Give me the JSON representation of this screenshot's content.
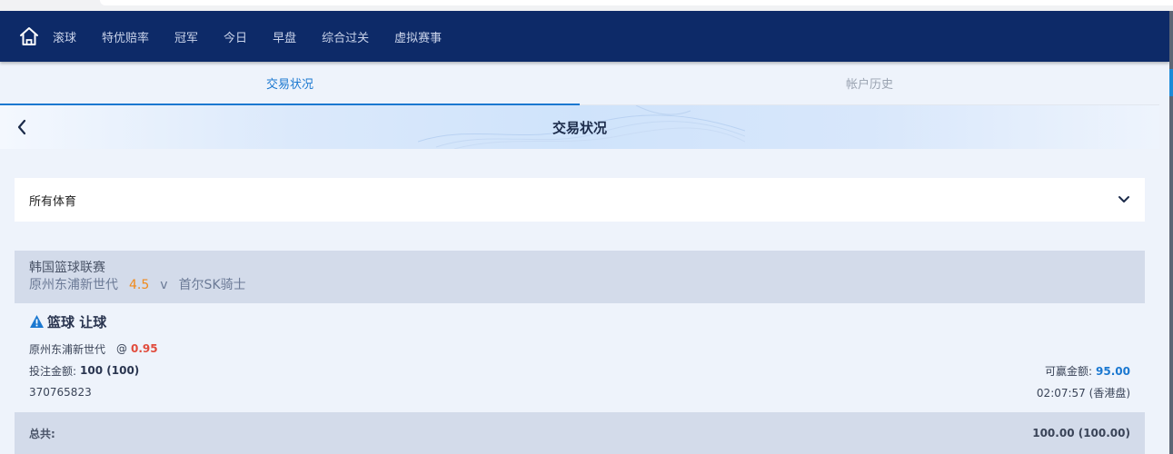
{
  "nav": {
    "items": [
      "滚球",
      "特优赔率",
      "冠军",
      "今日",
      "早盘",
      "综合过关",
      "虚拟赛事"
    ]
  },
  "tabs": [
    {
      "label": "交易状况",
      "active": true
    },
    {
      "label": "帐户历史",
      "active": false
    }
  ],
  "banner": {
    "title": "交易状况"
  },
  "filter": {
    "selected": "所有体育"
  },
  "league": {
    "name": "韩国篮球联赛",
    "home": "原州东浦新世代",
    "handicap": "4.5",
    "vs": "v",
    "away": "首尔SK骑士"
  },
  "bet": {
    "title": "篮球 让球",
    "selection": "原州东浦新世代",
    "at": "@",
    "odds": "0.95",
    "stake_label": "投注金额:",
    "stake_value": "100 (100)",
    "win_label": "可赢金额:",
    "win_value": "95.00",
    "ticket_id": "370765823",
    "time": "02:07:57 (香港盘)"
  },
  "total": {
    "label": "总共:",
    "value": "100.00 (100.00)"
  },
  "colors": {
    "navbar": "#0d2a68",
    "accent": "#1b78d0",
    "odds": "#e14b3c",
    "handicap": "#f08a1c"
  }
}
